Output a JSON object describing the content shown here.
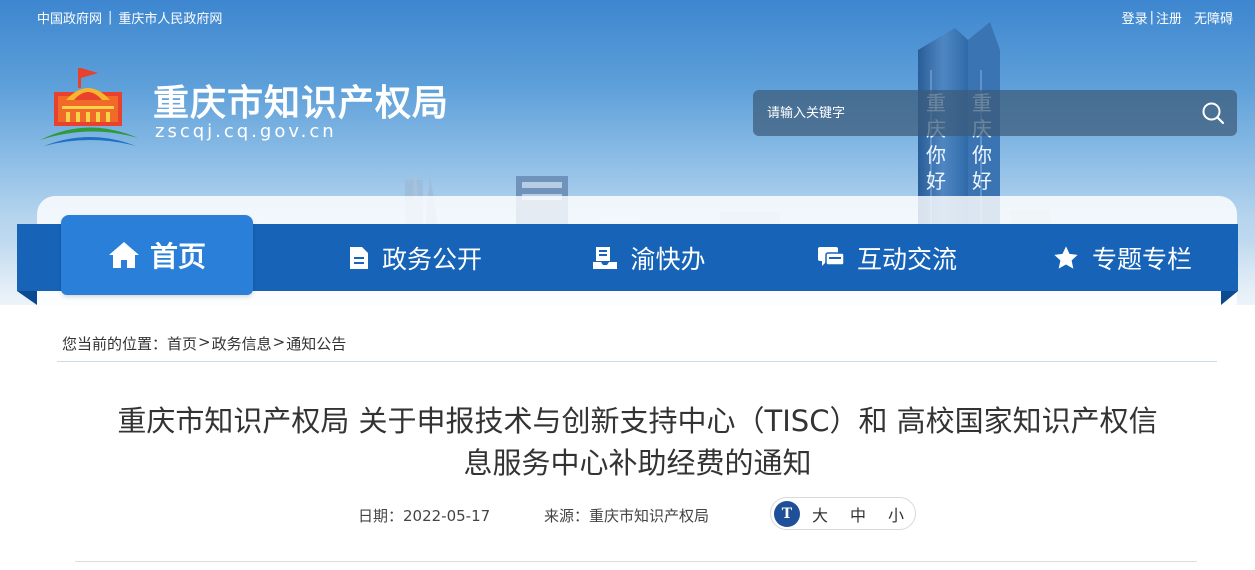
{
  "top_links": {
    "left": [
      "中国政府网",
      "重庆市人民政府网"
    ],
    "separator": "|",
    "login": "登录",
    "register": "注册",
    "accessibility": "无障碍"
  },
  "site": {
    "title": "重庆市知识产权局",
    "domain": "zscqj.cq.gov.cn"
  },
  "search": {
    "placeholder": "请输入关键字"
  },
  "nav": {
    "home": "首页",
    "items": [
      "政务公开",
      "渝快办",
      "互动交流",
      "专题专栏"
    ]
  },
  "breadcrumb": {
    "prefix": "您当前的位置：",
    "items": [
      "首页",
      "政务信息",
      "通知公告"
    ],
    "arrow": ">"
  },
  "article": {
    "title_line1": "重庆市知识产权局 关于申报技术与创新支持中心（TISC）和 高校国家知识产权信",
    "title_line2": "息服务中心补助经费的通知",
    "date": "日期：2022-05-17",
    "source": "来源：重庆市知识产权局"
  },
  "font_size": {
    "icon_text": "T",
    "options": [
      "大",
      "中",
      "小"
    ]
  },
  "colors": {
    "nav_blue": "#1663b8",
    "home_blue": "#2a7fd8",
    "banner_sky": "#5d9fd9"
  }
}
